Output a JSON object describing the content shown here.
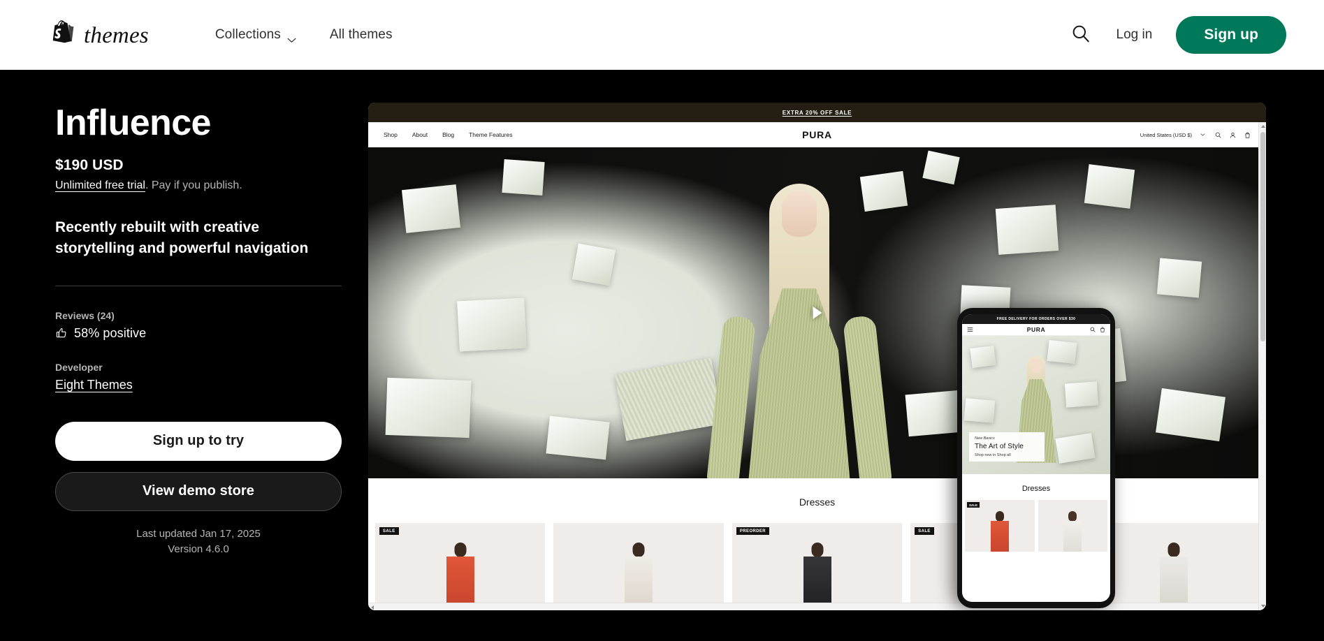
{
  "header": {
    "logo_word": "themes",
    "logo_icon": "shopify-bag-icon",
    "nav": [
      {
        "label": "Collections",
        "has_chevron": true
      },
      {
        "label": "All themes",
        "has_chevron": false
      }
    ],
    "search_icon": "search-icon",
    "login_label": "Log in",
    "signup_label": "Sign up",
    "accent_green": "#00785a"
  },
  "theme": {
    "title": "Influence",
    "price": "$190 USD",
    "trial_link": "Unlimited free trial",
    "trial_rest": ". Pay if you publish.",
    "tagline": "Recently rebuilt with creative storytelling and powerful navigation",
    "reviews_label": "Reviews (24)",
    "reviews_value": "58% positive",
    "reviews_icon": "thumbs-up-icon",
    "developer_label": "Developer",
    "developer_name": "Eight Themes",
    "primary_cta": "Sign up to try",
    "secondary_cta": "View demo store",
    "last_updated": "Last updated Jan 17, 2025",
    "version": "Version 4.6.0"
  },
  "preview": {
    "desktop": {
      "announcement": "EXTRA 20% OFF SALE",
      "nav": [
        "Shop",
        "About",
        "Blog",
        "Theme Features"
      ],
      "logo": "PURA",
      "locale": "United States (USD $)",
      "icons": [
        "search-icon",
        "account-icon",
        "cart-icon"
      ],
      "section_title": "Dresses",
      "product_tags": [
        "SALE",
        "",
        "PREORDER",
        "SALE",
        ""
      ]
    },
    "mobile": {
      "announcement": "FREE DELIVERY FOR ORDERS OVER $30",
      "logo": "PURA",
      "menu_icon": "hamburger-icon",
      "icons": [
        "search-icon",
        "cart-icon"
      ],
      "card_eyebrow": "New Basics",
      "card_title": "The Art of Style",
      "card_links": "Shop new in   Shop all",
      "section_title": "Dresses",
      "product_tags": [
        "SALE",
        ""
      ]
    }
  }
}
